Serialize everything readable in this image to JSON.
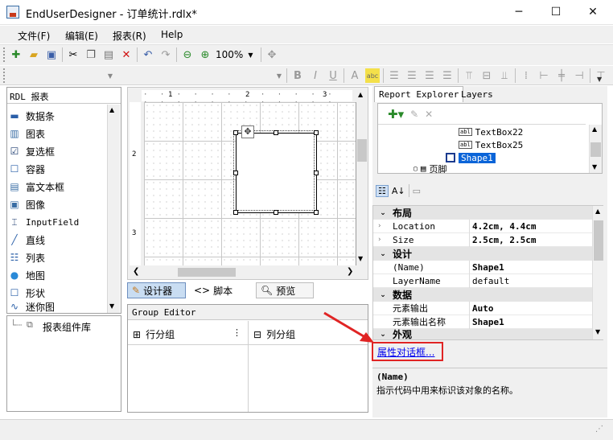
{
  "window": {
    "title": "EndUserDesigner - 订单统计.rdlx*",
    "controls": {
      "minimize": "─",
      "maximize": "☐",
      "close": "✕"
    }
  },
  "menu": [
    "文件(F)",
    "编辑(E)",
    "报表(R)",
    "Help"
  ],
  "toolbar": {
    "zoom": "100%"
  },
  "toolbox": {
    "header": "RDL 报表",
    "items": [
      {
        "label": "数据条",
        "icon": "databar-icon"
      },
      {
        "label": "图表",
        "icon": "chart-icon"
      },
      {
        "label": "复选框",
        "icon": "checkbox-icon"
      },
      {
        "label": "容器",
        "icon": "container-icon"
      },
      {
        "label": "富文本框",
        "icon": "richtext-icon"
      },
      {
        "label": "图像",
        "icon": "image-icon"
      },
      {
        "label": "InputField",
        "icon": "inputfield-icon"
      },
      {
        "label": "直线",
        "icon": "line-icon"
      },
      {
        "label": "列表",
        "icon": "list-icon"
      },
      {
        "label": "地图",
        "icon": "map-icon"
      },
      {
        "label": "形状",
        "icon": "shape-icon"
      },
      {
        "label": "迷你图",
        "icon": "sparkline-icon"
      }
    ],
    "library": "报表组件库"
  },
  "ruler": {
    "top": [
      "1",
      "2",
      "3"
    ],
    "left": [
      "2",
      "3"
    ]
  },
  "view_tabs": {
    "designer": "设计器",
    "script": "脚本",
    "preview": "预览"
  },
  "group_editor": {
    "title": "Group Editor",
    "row_groups": "行分组",
    "col_groups": "列分组"
  },
  "explorer": {
    "tabs": [
      "Report Explorer",
      "Layers"
    ],
    "tree": [
      {
        "label": "TextBox22",
        "icon": "textbox-icon",
        "selected": false
      },
      {
        "label": "TextBox25",
        "icon": "textbox-icon",
        "selected": false
      },
      {
        "label": "Shape1",
        "icon": "shape-icon",
        "selected": true
      },
      {
        "label": "页脚",
        "icon": "page-footer-icon",
        "selected": false
      }
    ]
  },
  "properties": {
    "rows": [
      {
        "type": "cat",
        "label": "布局"
      },
      {
        "type": "prop",
        "name": "Location",
        "value": "4.2cm, 4.4cm"
      },
      {
        "type": "prop",
        "name": "Size",
        "value": "2.5cm, 2.5cm"
      },
      {
        "type": "cat",
        "label": "设计"
      },
      {
        "type": "prop",
        "name": "(Name)",
        "value": "Shape1"
      },
      {
        "type": "prop",
        "name": "LayerName",
        "value": "default"
      },
      {
        "type": "cat",
        "label": "数据"
      },
      {
        "type": "prop",
        "name": "元素输出",
        "value": "Auto"
      },
      {
        "type": "prop",
        "name": "元素输出名称",
        "value": "Shape1"
      },
      {
        "type": "cat",
        "label": "外观"
      }
    ],
    "dialog_link": "属性对话框...",
    "desc_title": "(Name)",
    "desc_text": "指示代码中用来标识该对象的名称。"
  }
}
